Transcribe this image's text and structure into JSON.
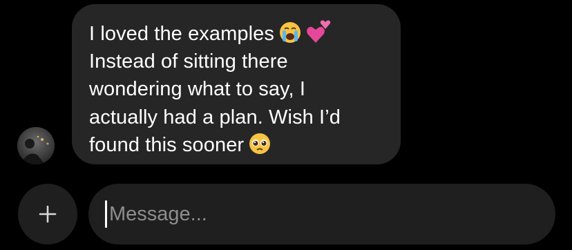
{
  "message": {
    "lines": [
      "I loved the examples",
      "Instead of sitting there",
      "wondering what to say, I",
      "actually had a plan. Wish I’d",
      "found this sooner"
    ],
    "emojis": [
      "loudly-crying-face",
      "two-hearts",
      "pleading-face"
    ]
  },
  "composer": {
    "placeholder": "Message...",
    "value": ""
  },
  "colors": {
    "background": "#000000",
    "bubble": "#262626",
    "composer": "#1f1f1f",
    "placeholder": "#8e8e8e",
    "text": "#ffffff"
  }
}
